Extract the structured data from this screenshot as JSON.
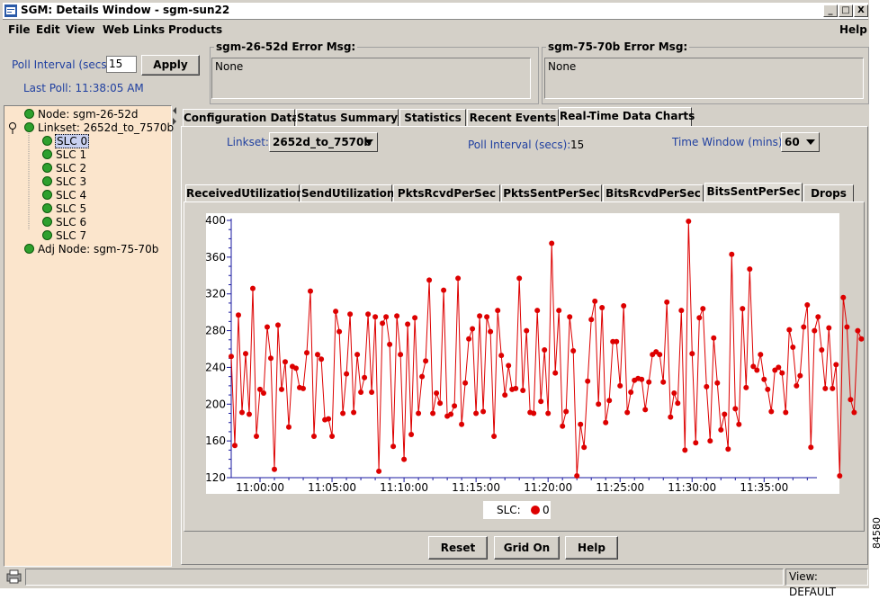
{
  "window": {
    "title": "SGM: Details Window - sgm-sun22",
    "minimize": "_",
    "maximize": "□",
    "close": "X"
  },
  "menu": {
    "file": "File",
    "edit": "Edit",
    "view": "View",
    "weblinks": "Web Links",
    "products": "Products",
    "help": "Help"
  },
  "poll": {
    "label": "Poll Interval (secs)",
    "value": "15",
    "apply": "Apply",
    "last_poll": "Last Poll:  11:38:05 AM"
  },
  "errors": [
    {
      "title": "sgm-26-52d  Error Msg:",
      "msg": "None"
    },
    {
      "title": "sgm-75-70b  Error Msg:",
      "msg": "None"
    }
  ],
  "tree": {
    "node": "Node: sgm-26-52d",
    "linkset": "Linkset: 2652d_to_7570b",
    "slcs": [
      "SLC 0",
      "SLC 1",
      "SLC 2",
      "SLC 3",
      "SLC 4",
      "SLC 5",
      "SLC 6",
      "SLC 7"
    ],
    "adj": "Adj Node: sgm-75-70b"
  },
  "main_tabs": [
    "Configuration Data",
    "Status Summary",
    "Statistics",
    "Recent Events",
    "Real-Time Data Charts"
  ],
  "controls": {
    "linkset_label": "Linkset:",
    "linkset_value": "2652d_to_7570b",
    "poll_label": "Poll Interval (secs):",
    "poll_value": "15",
    "window_label": "Time Window (mins):",
    "window_value": "60"
  },
  "chart_tabs": [
    "ReceivedUtilization",
    "SendUtilization",
    "PktsRcvdPerSec",
    "PktsSentPerSec",
    "BitsRcvdPerSec",
    "BitsSentPerSec",
    "Drops"
  ],
  "colors": {
    "series": "#dd0000",
    "tree_bg": "#fbe5cc",
    "axis": "#1a1aa0"
  },
  "chart_data": {
    "type": "line",
    "xlabel": "",
    "ylabel": "",
    "ylim": [
      120,
      400
    ],
    "yticks": [
      120,
      160,
      200,
      240,
      280,
      320,
      360,
      400
    ],
    "xlim": [
      "10:58:00",
      "11:38:40"
    ],
    "xticks": [
      "11:00:00",
      "11:05:00",
      "11:10:00",
      "11:15:00",
      "11:20:00",
      "11:25:00",
      "11:30:00",
      "11:35:00"
    ],
    "grid": false,
    "series": [
      {
        "name": "0",
        "color": "#dd0000",
        "x_start": "10:58:00",
        "x_step_secs": 15,
        "values": [
          252,
          155,
          297,
          191,
          255,
          189,
          326,
          165,
          216,
          212,
          284,
          250,
          129,
          286,
          216,
          246,
          175,
          241,
          239,
          218,
          217,
          256,
          323,
          165,
          254,
          249,
          183,
          184,
          165,
          301,
          279,
          190,
          233,
          298,
          191,
          254,
          213,
          229,
          298,
          213,
          295,
          127,
          288,
          295,
          265,
          154,
          296,
          254,
          140,
          287,
          167,
          294,
          190,
          230,
          247,
          335,
          190,
          212,
          201,
          324,
          187,
          189,
          198,
          337,
          178,
          223,
          271,
          282,
          190,
          296,
          192,
          295,
          279,
          165,
          302,
          253,
          210,
          242,
          216,
          217,
          337,
          215,
          280,
          191,
          190,
          302,
          203,
          259,
          190,
          375,
          234,
          302,
          176,
          192,
          295,
          258,
          122,
          178,
          153,
          225,
          292,
          312,
          200,
          305,
          180,
          204,
          268,
          268,
          220,
          307,
          191,
          213,
          226,
          228,
          227,
          194,
          224,
          254,
          257,
          254,
          224,
          311,
          186,
          212,
          201,
          302,
          150,
          399,
          255,
          158,
          294,
          304,
          219,
          160,
          272,
          223,
          172,
          189,
          151,
          363,
          195,
          178,
          304,
          218,
          347,
          241,
          237,
          254,
          227,
          216,
          192,
          237,
          240,
          234,
          191,
          281,
          262,
          220,
          231,
          284,
          308,
          153,
          280,
          295,
          259,
          217,
          283,
          217,
          243,
          122,
          316,
          284,
          205,
          191,
          280,
          271
        ]
      }
    ],
    "legend": {
      "label": "SLC:",
      "entries": [
        "0"
      ]
    }
  },
  "buttons": {
    "reset": "Reset",
    "grid": "Grid On",
    "help": "Help"
  },
  "status": {
    "view": "View: DEFAULT"
  },
  "figure_number": "84580"
}
